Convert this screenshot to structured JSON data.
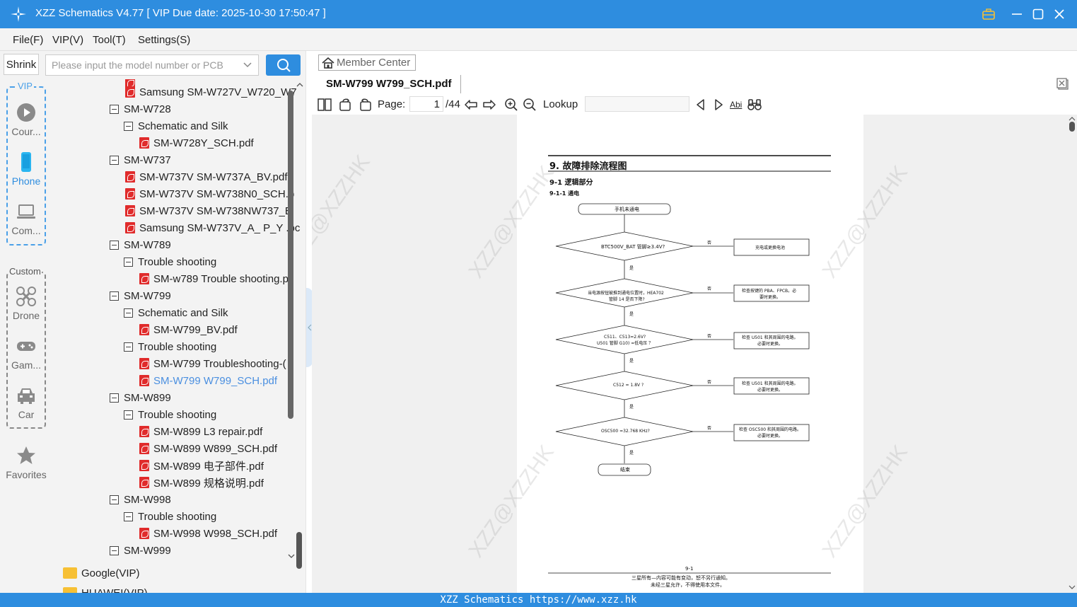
{
  "window": {
    "title": "XZZ Schematics V4.77 [ VIP Due date: 2025-10-30 17:50:47 ]"
  },
  "menu": [
    "File(F)",
    "VIP(V)",
    "Tool(T)",
    "Settings(S)"
  ],
  "search": {
    "shrink_label": "Shrink",
    "placeholder": "Please input the model number or PCB"
  },
  "categories": {
    "vip_label": "VIP",
    "custom_label": "Custom",
    "items": [
      "Cour...",
      "Phone",
      "Com...",
      "Drone",
      "Gam...",
      "Car"
    ],
    "favorites": "Favorites"
  },
  "tree": [
    {
      "text": "Samsung SM-W727V_W720_W7",
      "type": "pdf"
    },
    {
      "text": "SM-W728",
      "type": "node"
    },
    {
      "text": "Schematic and Silk",
      "type": "node"
    },
    {
      "text": "SM-W728Y_SCH.pdf",
      "type": "pdf"
    },
    {
      "text": "SM-W737",
      "type": "node"
    },
    {
      "text": "SM-W737V SM-W737A_BV.pdf",
      "type": "pdf"
    },
    {
      "text": "SM-W737V SM-W738N0_SCH.p",
      "type": "pdf"
    },
    {
      "text": "SM-W737V SM-W738NW737_B",
      "type": "pdf"
    },
    {
      "text": "Samsung SM-W737V_A_ P_Y .pc",
      "type": "pdf"
    },
    {
      "text": "SM-W789",
      "type": "node"
    },
    {
      "text": "Trouble shooting",
      "type": "node"
    },
    {
      "text": "SM-w789 Trouble shooting.p",
      "type": "pdf"
    },
    {
      "text": "SM-W799",
      "type": "node"
    },
    {
      "text": "Schematic and Silk",
      "type": "node"
    },
    {
      "text": "SM-W799_BV.pdf",
      "type": "pdf"
    },
    {
      "text": "Trouble shooting",
      "type": "node"
    },
    {
      "text": "SM-W799 Troubleshooting-(",
      "type": "pdf"
    },
    {
      "text": "SM-W799 W799_SCH.pdf",
      "type": "pdf",
      "selected": true
    },
    {
      "text": "SM-W899",
      "type": "node"
    },
    {
      "text": "Trouble shooting",
      "type": "node"
    },
    {
      "text": "SM-W899 L3 repair.pdf",
      "type": "pdf"
    },
    {
      "text": "SM-W899 W899_SCH.pdf",
      "type": "pdf"
    },
    {
      "text": "SM-W899 电子部件.pdf",
      "type": "pdf"
    },
    {
      "text": "SM-W899 规格说明.pdf",
      "type": "pdf"
    },
    {
      "text": "SM-W998",
      "type": "node"
    },
    {
      "text": "Trouble shooting",
      "type": "node"
    },
    {
      "text": "SM-W998 W998_SCH.pdf",
      "type": "pdf"
    },
    {
      "text": "SM-W999",
      "type": "node"
    },
    {
      "text": "Google(VIP)",
      "type": "folder"
    },
    {
      "text": "HUAWEI(VIP)",
      "type": "folder"
    }
  ],
  "viewer": {
    "member_center": "Member Center",
    "tab_title": "SM-W799 W799_SCH.pdf",
    "page_label": "Page:",
    "page_value": "1",
    "page_total": "/44",
    "lookup_label": "Lookup",
    "abi": "Abi"
  },
  "document": {
    "heading": "9. 故障排除流程图",
    "sub1": "9-1  逻辑部分",
    "sub2": "9-1-1  通电",
    "start": "手机未通电",
    "q1": "BTC500V_BAT 管脚≥3.4V?",
    "a1": "充电或更换电池",
    "q2a": "当电源按钮被推到通电位置时，HEA702",
    "q2b": "管脚 14 是否下降?",
    "a2a": "检查按键的 PBA、FPCB。必",
    "a2b": "要时更换。",
    "q3a": "C511、C513=2.6V?",
    "q3b": "U501 管脚 G10) =低电压 ？",
    "a3a": "检查 U501 和其周围的电路。",
    "a3b": "必要时更换。",
    "q4": "C512 = 1.8V ?",
    "a4a": "检查 U501 和其周围的电路。",
    "a4b": "必要时更换。",
    "q5": "OSC500 =32.768 KHz?",
    "a5a": "检查 OSC500 和其周围的电路。",
    "a5b": "必要时更换。",
    "end": "结束",
    "no": "否",
    "yes": "是",
    "page_num": "9-1",
    "footer1": "三星所有—内容可能有变动，恕不另行通知。",
    "footer2": "未经三星允许，不得使用本文件。",
    "watermark": "XZZ@XZZHK"
  },
  "status": {
    "text": "XZZ Schematics https://www.xzz.hk"
  },
  "colors": {
    "accent": "#2e8ddf",
    "pdf_icon": "#e02b2b",
    "folder": "#f7c034",
    "selected_text": "#4a8fe0"
  }
}
